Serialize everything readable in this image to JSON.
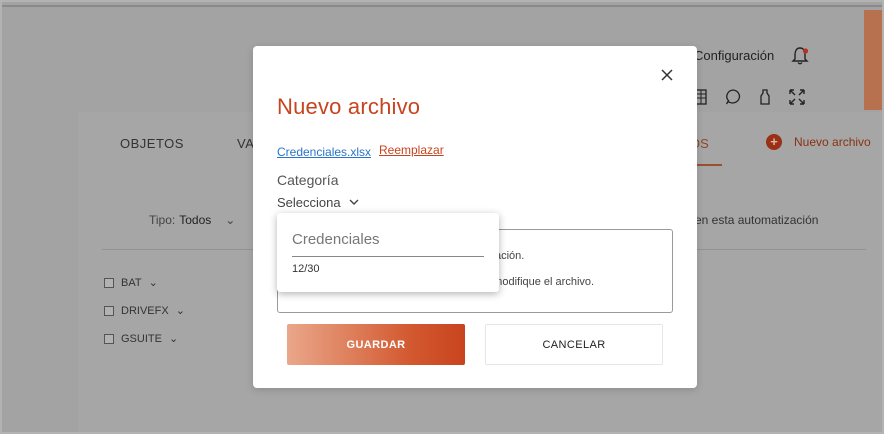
{
  "background": {
    "config_label": "Configuración",
    "tabs": {
      "objetos": "OBJETOS",
      "variables_partial": "VA",
      "archivos_partial": "OS"
    },
    "new_file_label": "Nuevo archivo",
    "filter": {
      "label": "Tipo:",
      "value": "Todos"
    },
    "automation_text": "en esta automatización",
    "list": [
      {
        "label": "BAT"
      },
      {
        "label": "DRIVEFX"
      },
      {
        "label": "GSUITE"
      }
    ],
    "colors": {
      "accent": "#c8441e",
      "overlay": "#a6a6a6"
    }
  },
  "modal": {
    "title": "Nuevo archivo",
    "file_name": "Credenciales.xlsx",
    "replace_label": "Reemplazar",
    "category_label": "Categoría",
    "category_select": "Selecciona",
    "description_line1": "tización.",
    "description_line2": "e modifique el archivo.",
    "dropdown": {
      "input_value": "Credenciales",
      "counter": "12/30"
    },
    "save_label": "GUARDAR",
    "cancel_label": "CANCELAR"
  }
}
